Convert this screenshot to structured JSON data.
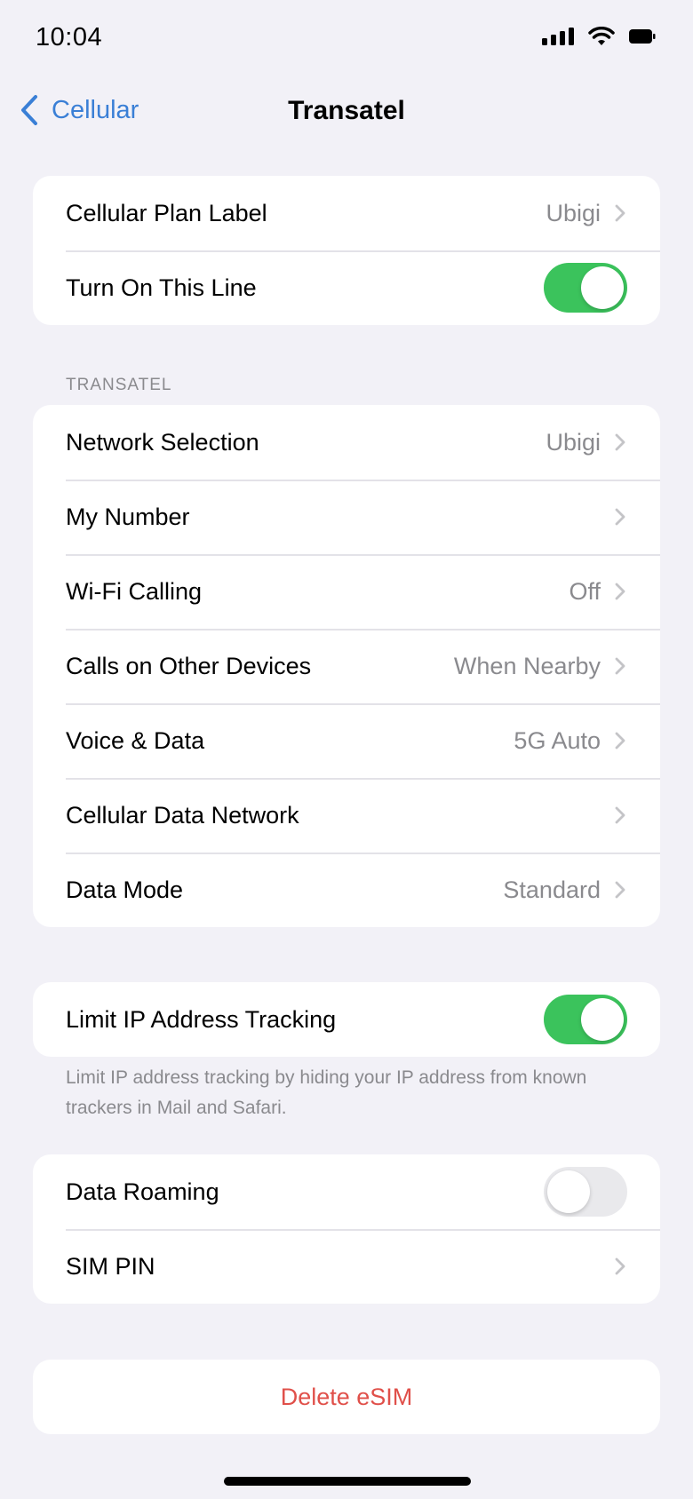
{
  "status_bar": {
    "time": "10:04"
  },
  "nav": {
    "back_label": "Cellular",
    "title": "Transatel"
  },
  "group1": {
    "plan_label": {
      "label": "Cellular Plan Label",
      "value": "Ubigi"
    },
    "turn_on_line": {
      "label": "Turn On This Line",
      "state": "on"
    }
  },
  "section_header": "TRANSATEL",
  "group2": [
    {
      "label": "Network Selection",
      "value": "Ubigi"
    },
    {
      "label": "My Number",
      "value": ""
    },
    {
      "label": "Wi-Fi Calling",
      "value": "Off"
    },
    {
      "label": "Calls on Other Devices",
      "value": "When Nearby"
    },
    {
      "label": "Voice & Data",
      "value": "5G Auto"
    },
    {
      "label": "Cellular Data Network",
      "value": ""
    },
    {
      "label": "Data Mode",
      "value": "Standard"
    }
  ],
  "group3": {
    "limit_ip": {
      "label": "Limit IP Address Tracking",
      "state": "on"
    },
    "footer": "Limit IP address tracking by hiding your IP address from known trackers in Mail and Safari."
  },
  "group4": {
    "roaming": {
      "label": "Data Roaming",
      "state": "off"
    },
    "sim_pin": {
      "label": "SIM PIN"
    }
  },
  "delete_esim": {
    "label": "Delete eSIM"
  },
  "colors": {
    "accent": "#3a7fd6",
    "toggle_on": "#3bc35c",
    "danger": "#e0504a",
    "background": "#f2f1f7"
  }
}
